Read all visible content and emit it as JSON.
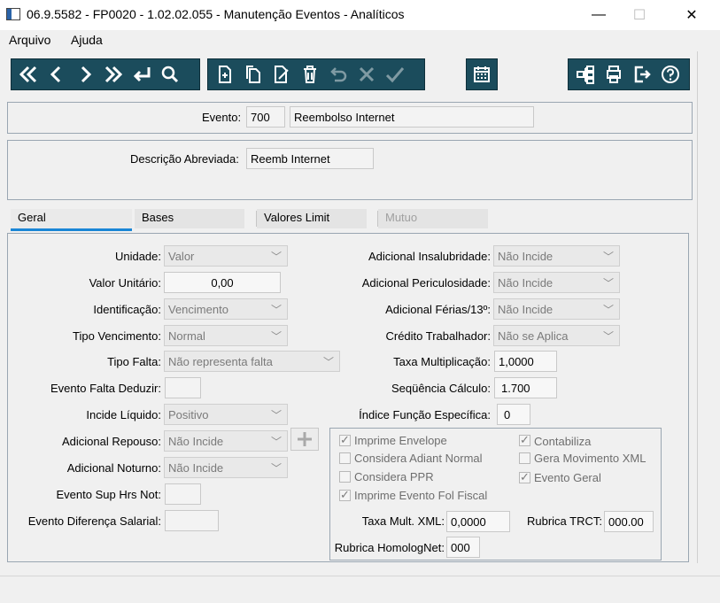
{
  "window": {
    "title": "06.9.5582 - FP0020 - 1.02.02.055 - Manutenção Eventos - Analíticos",
    "minimize": "—",
    "maximize": "☐",
    "close": "✕"
  },
  "menu": {
    "arquivo": "Arquivo",
    "ajuda": "Ajuda"
  },
  "toolbar": {
    "nav": [
      "first-icon",
      "prev-icon",
      "next-icon",
      "last-icon",
      "return-icon",
      "search-icon"
    ],
    "edit": [
      "new-icon",
      "copy-icon",
      "edit-icon",
      "delete-icon",
      "undo-icon",
      "cancel-icon",
      "confirm-icon"
    ],
    "calendar": "calendar-icon",
    "right": [
      "tree-icon",
      "print-icon",
      "exit-icon",
      "help-icon"
    ]
  },
  "header": {
    "evento_label": "Evento:",
    "evento_code": "700",
    "evento_name": "Reembolso Internet",
    "descricao_label": "Descrição Abreviada:",
    "descricao_value": "Reemb Internet"
  },
  "tabs": [
    "Geral",
    "Bases",
    "Valores Limit",
    "Mutuo"
  ],
  "left": {
    "unidade_label": "Unidade:",
    "unidade_value": "Valor",
    "valor_label": "Valor Unitário:",
    "valor_value": "0,00",
    "ident_label": "Identificação:",
    "ident_value": "Vencimento",
    "tipovenc_label": "Tipo Vencimento:",
    "tipovenc_value": "Normal",
    "tipofalta_label": "Tipo Falta:",
    "tipofalta_value": "Não representa falta",
    "eventofalta_label": "Evento Falta Deduzir:",
    "eventofalta_value": "",
    "incide_label": "Incide Líquido:",
    "incide_value": "Positivo",
    "adrep_label": "Adicional Repouso:",
    "adrep_value": "Não Incide",
    "adnot_label": "Adicional Noturno:",
    "adnot_value": "Não Incide",
    "supHrs_label": "Evento Sup Hrs Not:",
    "supHrs_value": "",
    "difsal_label": "Evento Diferença Salarial:",
    "difsal_value": ""
  },
  "right": {
    "insal_label": "Adicional Insalubridade:",
    "insal_value": "Não Incide",
    "peric_label": "Adicional Periculosidade:",
    "peric_value": "Não Incide",
    "ferias_label": "Adicional Férias/13º:",
    "ferias_value": "Não Incide",
    "credito_label": "Crédito Trabalhador:",
    "credito_value": "Não se Aplica",
    "taxa_label": "Taxa Multiplicação:",
    "taxa_value": "1,0000",
    "seq_label": "Seqüência Cálculo:",
    "seq_value": "1.700",
    "indice_label": "Índice Função Específica:",
    "indice_value": "0"
  },
  "checks": {
    "imprime_envelope": "Imprime Envelope",
    "considera_adiant": "Considera Adiant Normal",
    "considera_ppr": "Considera PPR",
    "imprime_evento": "Imprime Evento Fol Fiscal",
    "contabiliza": "Contabiliza",
    "gera_mov": "Gera Movimento XML",
    "evento_geral": "Evento Geral"
  },
  "group": {
    "taxaxml_label": "Taxa Mult. XML:",
    "taxaxml_value": "0,0000",
    "rubrica_trct_label": "Rubrica TRCT:",
    "rubrica_trct_value": "000.00",
    "homolog_label": "Rubrica HomologNet:",
    "homolog_value": "000"
  },
  "colors": {
    "toolbar": "#1b4c5c",
    "tab_active": "#1a86d6"
  }
}
